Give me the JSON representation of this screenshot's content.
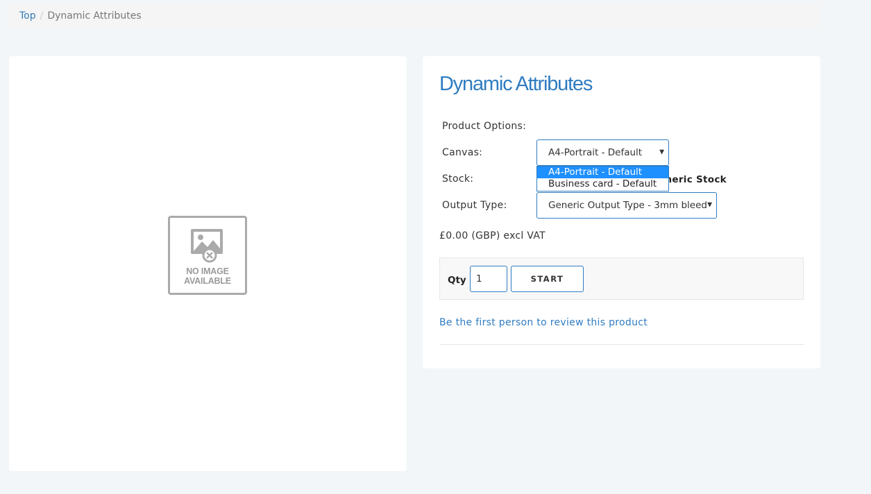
{
  "breadcrumb": {
    "top": "Top",
    "separator": "/",
    "current": "Dynamic Attributes"
  },
  "image_placeholder": {
    "line1": "NO IMAGE",
    "line2": "AVAILABLE"
  },
  "product": {
    "title": "Dynamic Attributes",
    "options_heading": "Product Options:",
    "canvas": {
      "label": "Canvas:",
      "value": "A4-Portrait - Default",
      "options": [
        "A4-Portrait - Default",
        "Business card - Default"
      ],
      "highlighted_option": "A4-Portrait - Default"
    },
    "stock": {
      "label": "Stock:",
      "value": "Generic Stock",
      "visible_value": "eneric Stock"
    },
    "output_type": {
      "label": "Output Type:",
      "value": "Generic Output Type - 3mm bleed"
    },
    "price": "£0.00 (GBP) excl VAT",
    "qty_label": "Qty",
    "qty_value": "1",
    "start_label": "START",
    "review_link": "Be the first person to review this product"
  },
  "colors": {
    "accent": "#2f7cc1",
    "highlight": "#1e90ff",
    "page_bg": "#f2f6f9"
  },
  "icons": {
    "dropdown_arrow": "▼",
    "placeholder_icon": "no-image-icon"
  }
}
